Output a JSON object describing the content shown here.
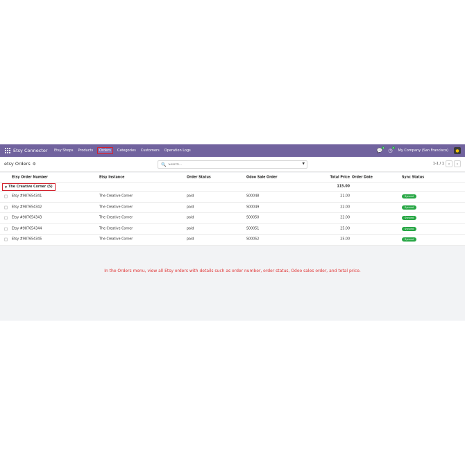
{
  "navbar": {
    "brand": "Etsy Connector",
    "items": [
      "Etsy Shops",
      "Products",
      "Orders",
      "Categories",
      "Customers",
      "Operation Logs"
    ],
    "active_item": "Orders",
    "chat_count": "1",
    "activity_count": "4",
    "company": "My Company (San Francisco)"
  },
  "control": {
    "title": "etsy Orders",
    "search_placeholder": "Search...",
    "pager": "1-1 / 1"
  },
  "table": {
    "columns": {
      "order_number": "Etsy Order Number",
      "instance": "Etsy Instance",
      "status": "Order Status",
      "sale_order": "Odoo Sale Order",
      "total_price": "Total Price",
      "order_date": "Order Date",
      "sync_status": "Sync Status"
    },
    "group": {
      "label": "The Creative Corner (5)",
      "total": "115.00"
    },
    "rows": [
      {
        "order_number": "Etsy #987654341",
        "instance": "The Creative Corner",
        "status": "paid",
        "sale_order": "S00048",
        "total_price": "21.00",
        "sync": "Synced"
      },
      {
        "order_number": "Etsy #987654342",
        "instance": "The Creative Corner",
        "status": "paid",
        "sale_order": "S00049",
        "total_price": "22.00",
        "sync": "Synced"
      },
      {
        "order_number": "Etsy #987654343",
        "instance": "The Creative Corner",
        "status": "paid",
        "sale_order": "S00050",
        "total_price": "22.00",
        "sync": "Synced"
      },
      {
        "order_number": "Etsy #987654344",
        "instance": "The Creative Corner",
        "status": "paid",
        "sale_order": "S00051",
        "total_price": "25.00",
        "sync": "Synced"
      },
      {
        "order_number": "Etsy #987654345",
        "instance": "The Creative Corner",
        "status": "paid",
        "sale_order": "S00052",
        "total_price": "25.00",
        "sync": "Synced"
      }
    ]
  },
  "note": "In the Orders menu, view all Etsy orders with details such as order number, order status, Odoo sales order, and total price.",
  "colors": {
    "navbar": "#71639e",
    "highlight": "#d3212c",
    "synced": "#28a745",
    "note": "#e03333"
  }
}
